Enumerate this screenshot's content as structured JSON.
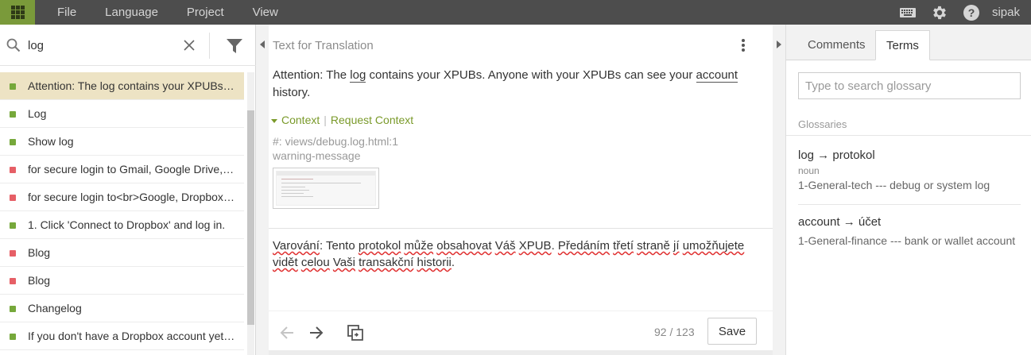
{
  "topbar": {
    "menu": [
      "File",
      "Language",
      "Project",
      "View"
    ],
    "icons": [
      "apps-grid-icon",
      "keyboard-icon",
      "gear-icon",
      "help-icon"
    ],
    "user": "sipak",
    "accent": "#7a9a3a"
  },
  "search": {
    "value": "log",
    "icons": [
      "search-icon",
      "clear-icon",
      "filter-icon"
    ]
  },
  "list": {
    "items": [
      {
        "text": "Attention: The log contains your XPUBs. Anyone with your XPUBs can see your account history.",
        "status": "green",
        "active": true
      },
      {
        "text": "Log",
        "status": "green"
      },
      {
        "text": "Show log",
        "status": "green"
      },
      {
        "text": "for secure login to Gmail, Google Drive, Dropbox and other services.",
        "status": "red"
      },
      {
        "text": "for secure login to<br>Google, Dropbox, and other services.",
        "status": "red"
      },
      {
        "text": "1. Click 'Connect to Dropbox' and log in.",
        "status": "green"
      },
      {
        "text": "Blog",
        "status": "red"
      },
      {
        "text": "Blog",
        "status": "red"
      },
      {
        "text": "Changelog",
        "status": "green"
      },
      {
        "text": "If you don't have a Dropbox account yet, create one.",
        "status": "green"
      }
    ],
    "status_colors": {
      "green": "#76a83b",
      "red": "#e65f66"
    }
  },
  "editor": {
    "source_label": "Text for Translation",
    "source_before": "Attention: The ",
    "source_term1": "log",
    "source_middle": " contains your XPUBs. Anyone with your XPUBs can see your ",
    "source_term2": "account",
    "source_after": " history.",
    "context_label": "Context",
    "request_context": "Request Context",
    "location": "#: views/debug.log.html:1",
    "context_key": "warning-message",
    "translation": [
      "Varování",
      ": Tento ",
      "protokol",
      " ",
      "může",
      " ",
      "obsahovat",
      " ",
      "Váš",
      " ",
      "XPUB",
      ". ",
      "Předáním",
      " ",
      "třetí",
      " ",
      "straně",
      " ",
      "jí",
      " ",
      "umožňujete",
      " ",
      "vidět",
      " ",
      "celou",
      " ",
      "Vaši",
      " ",
      "transakční",
      " ",
      "historii",
      "."
    ],
    "counter": "92 / 123",
    "save_label": "Save",
    "icons": [
      "prev-arrow-icon",
      "next-arrow-icon",
      "copy-source-icon",
      "more-vert-icon"
    ]
  },
  "glossary": {
    "tabs": [
      "Comments",
      "Terms"
    ],
    "active_tab": "Terms",
    "search_placeholder": "Type to search glossary",
    "heading": "Glossaries",
    "entries": [
      {
        "term": "log → protokol",
        "pos": "noun",
        "desc": "1-General-tech --- debug or system log"
      },
      {
        "term": "account → účet",
        "pos": "",
        "desc": "1-General-finance --- bank or wallet account"
      }
    ]
  }
}
